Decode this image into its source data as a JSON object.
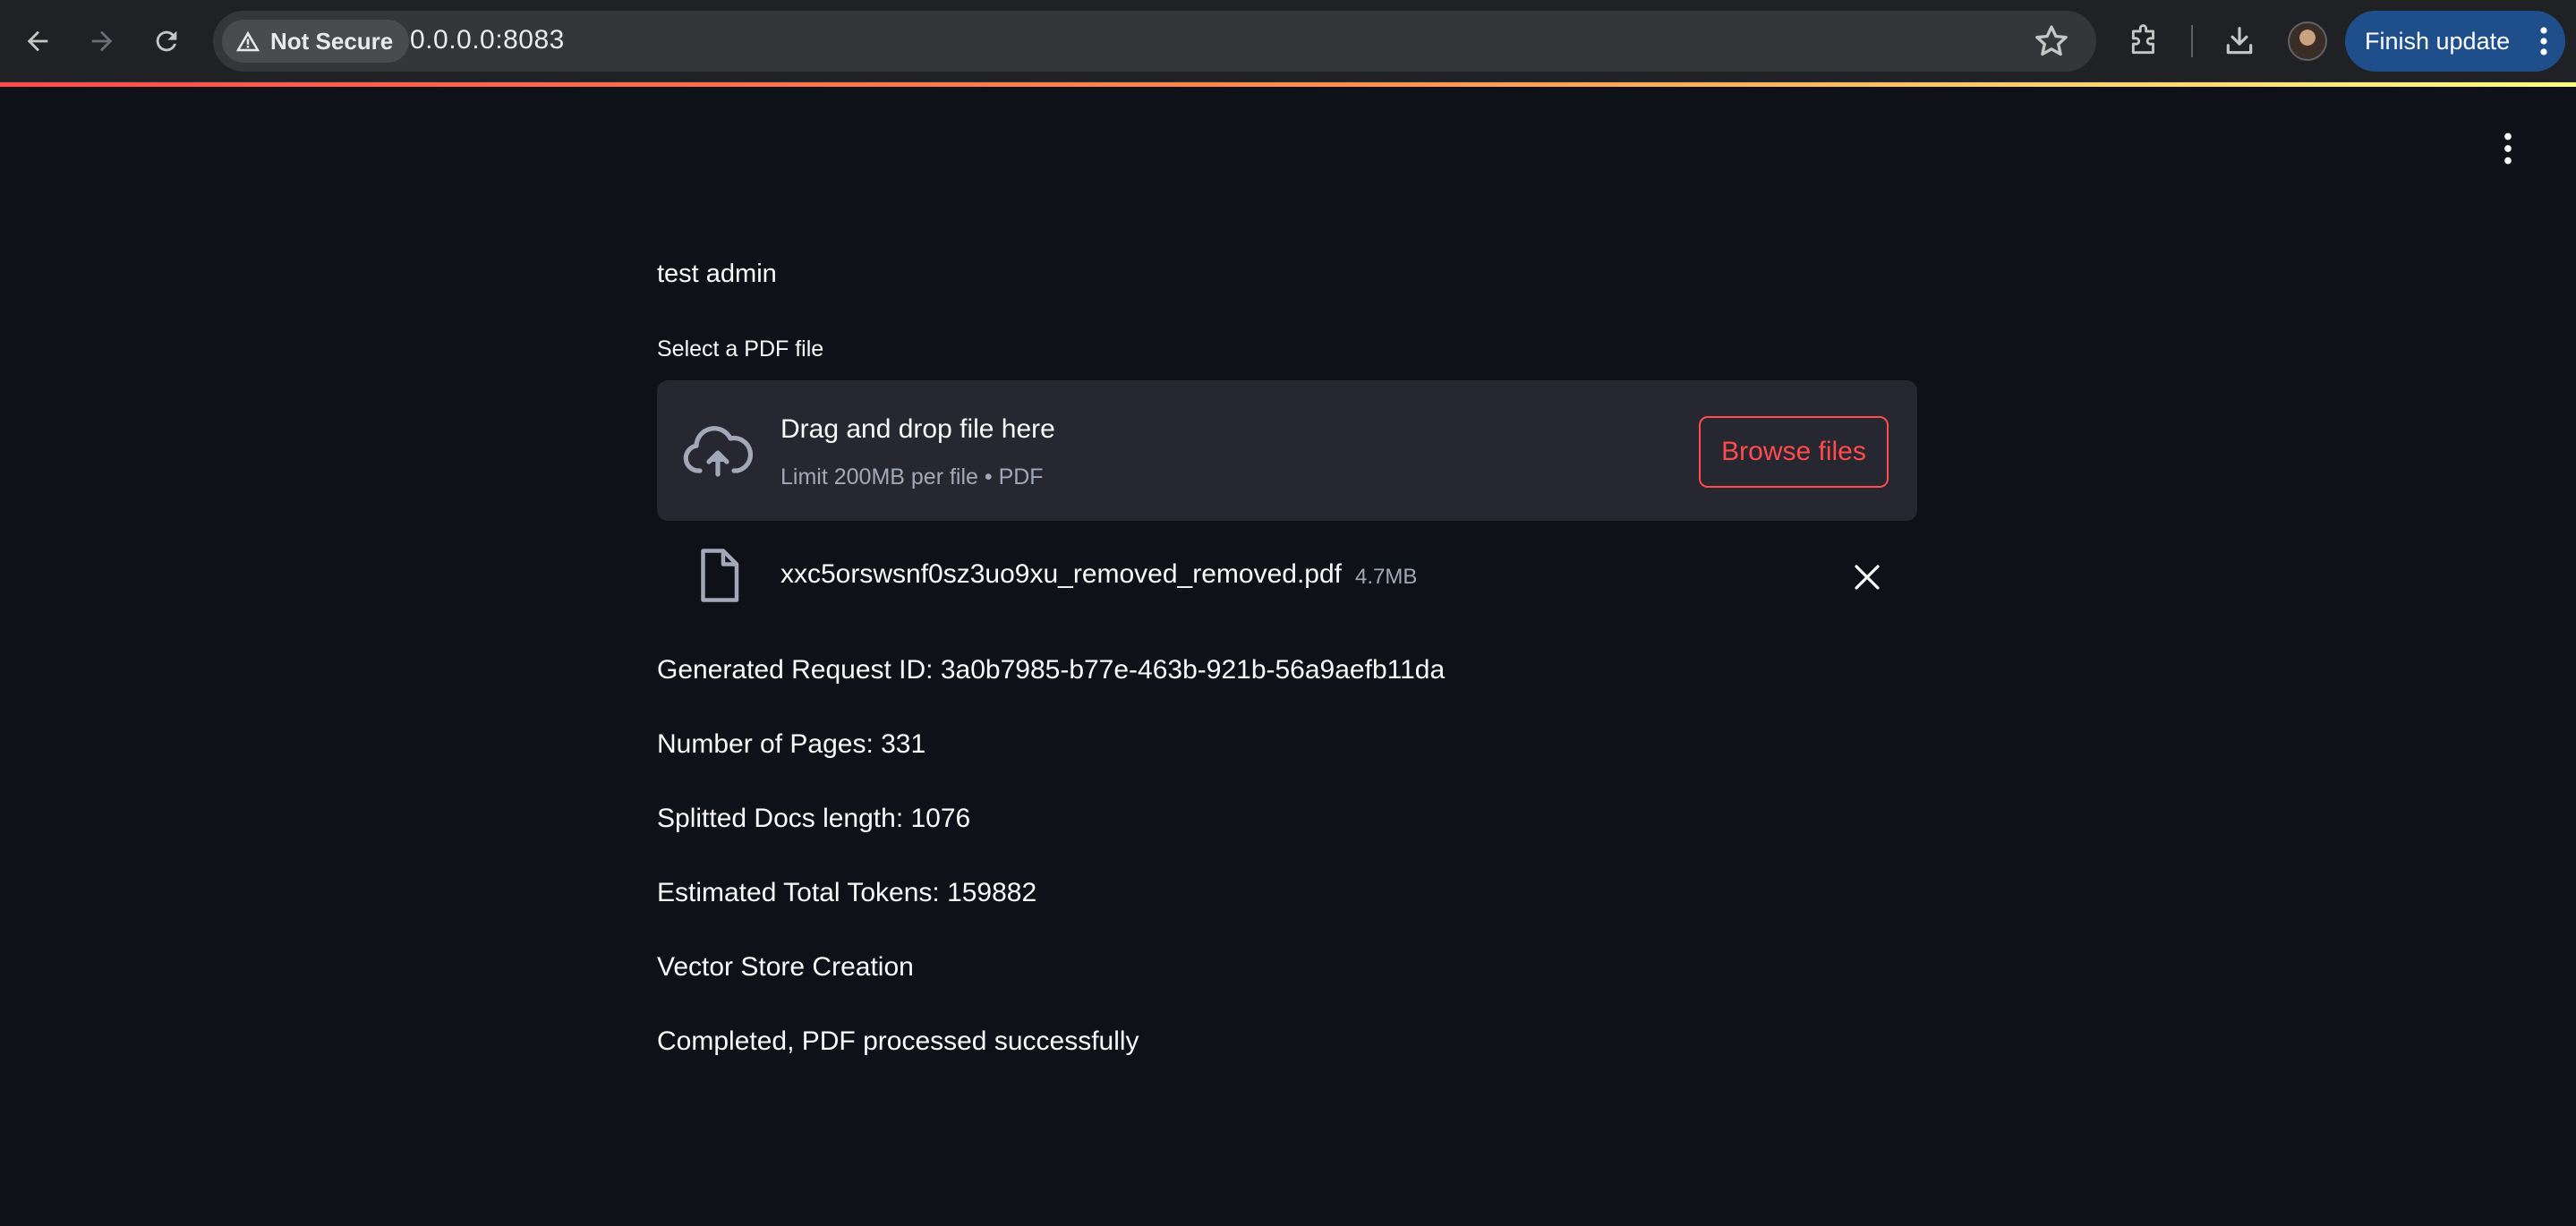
{
  "browser": {
    "security_label": "Not Secure",
    "url": "0.0.0.0:8083",
    "finish_update_label": "Finish update",
    "icons": {
      "back": "back-arrow-icon",
      "forward": "forward-arrow-icon",
      "reload": "reload-icon",
      "warning": "warning-triangle-icon",
      "bookmark": "star-icon",
      "extensions": "puzzle-icon",
      "downloads": "download-icon",
      "menu": "kebab-menu-icon"
    },
    "accent_color": "#1f4f8a"
  },
  "app": {
    "background": "#0e1117",
    "primary_color": "#ff4b4b",
    "user_name": "test admin",
    "uploader": {
      "label": "Select a PDF file",
      "drop_title": "Drag and drop file here",
      "drop_subtitle": "Limit 200MB per file • PDF",
      "browse_label": "Browse files",
      "uploaded_file": {
        "name": "xxc5orswsnf0sz3uo9xu_removed_removed.pdf",
        "size": "4.7MB"
      }
    },
    "output_lines": [
      "Generated Request ID: 3a0b7985-b77e-463b-921b-56a9aefb11da",
      "Number of Pages: 331",
      "Splitted Docs length: 1076",
      "Estimated Total Tokens: 159882",
      "Vector Store Creation",
      "Completed, PDF processed successfully"
    ]
  }
}
